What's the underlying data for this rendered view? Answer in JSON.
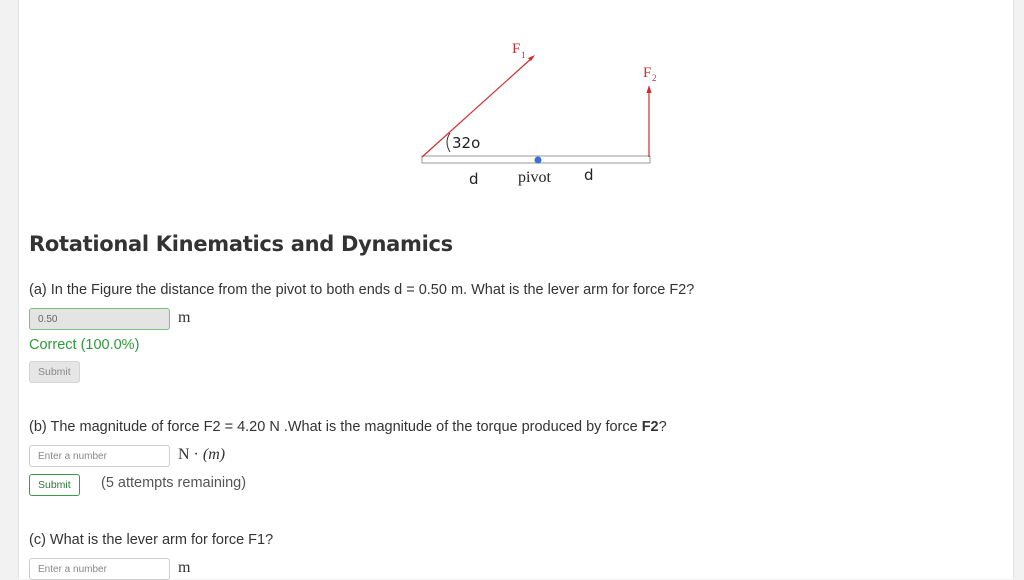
{
  "figure": {
    "angle_label": "32o",
    "label_d_left": "d",
    "label_pivot": "pivot",
    "label_d_right": "d",
    "label_f1_main": "F",
    "label_f1_sub": "1",
    "label_f2_main": "F",
    "label_f2_sub": "2",
    "force_color": "#d42a2a",
    "pivot_color": "#3a6fd8"
  },
  "title": "Rotational Kinematics and Dynamics",
  "part_a": {
    "question": "(a) In the Figure the distance from the pivot to both ends d = 0.50 m. What is the lever arm for force F2?",
    "input_value": "0.50",
    "unit": "m",
    "feedback": "Correct (100.0%)",
    "submit_label": "Submit"
  },
  "part_b": {
    "question_prefix": "(b) The magnitude of force F2 = 4.20 N .What is the magnitude of the torque produced by force ",
    "question_bold": "F2",
    "question_suffix": "?",
    "input_placeholder": "Enter a number",
    "unit_main": "N · ",
    "unit_italic": "(m)",
    "submit_label": "Submit",
    "attempts": "(5 attempts remaining)"
  },
  "part_c": {
    "question": "(c) What is the lever arm for force F1?",
    "input_placeholder": "Enter a number",
    "unit": "m"
  }
}
